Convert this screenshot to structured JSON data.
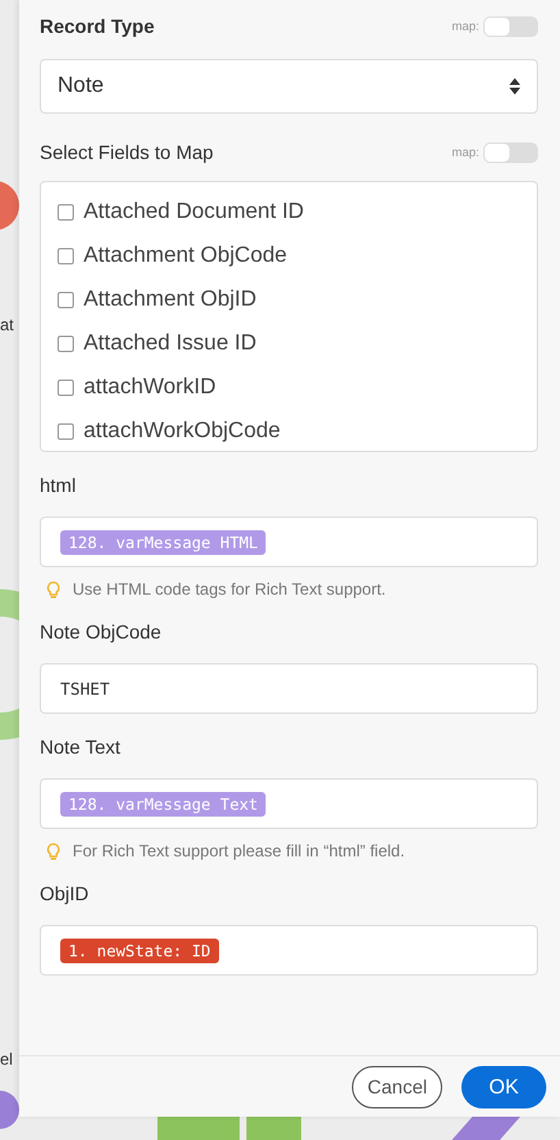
{
  "background": {
    "labels": [
      "at",
      "el"
    ]
  },
  "record_type": {
    "label": "Record Type",
    "map_label": "map:",
    "map_on": false,
    "value": "Note"
  },
  "fields_to_map": {
    "label": "Select Fields to Map",
    "map_label": "map:",
    "map_on": false,
    "options": [
      {
        "label": "Attached Document ID",
        "checked": false
      },
      {
        "label": "Attachment ObjCode",
        "checked": false
      },
      {
        "label": "Attachment ObjID",
        "checked": false
      },
      {
        "label": "Attached Issue ID",
        "checked": false
      },
      {
        "label": "attachWorkID",
        "checked": false
      },
      {
        "label": "attachWorkObjCode",
        "checked": false
      }
    ]
  },
  "fields": [
    {
      "label": "html",
      "kind": "pill",
      "value": "128. varMessage HTML",
      "color": "#b09ae8",
      "hint": "Use HTML code tags for Rich Text support."
    },
    {
      "label": "Note ObjCode",
      "kind": "text",
      "value": "TSHET"
    },
    {
      "label": "Note Text",
      "kind": "pill",
      "value": "128. varMessage Text",
      "color": "#b09ae8",
      "hint": "For Rich Text support please fill in “html” field."
    },
    {
      "label": "ObjID",
      "kind": "pill",
      "value": "1. newState: ID",
      "color": "#d9462b"
    }
  ],
  "buttons": {
    "cancel": "Cancel",
    "ok": "OK"
  }
}
